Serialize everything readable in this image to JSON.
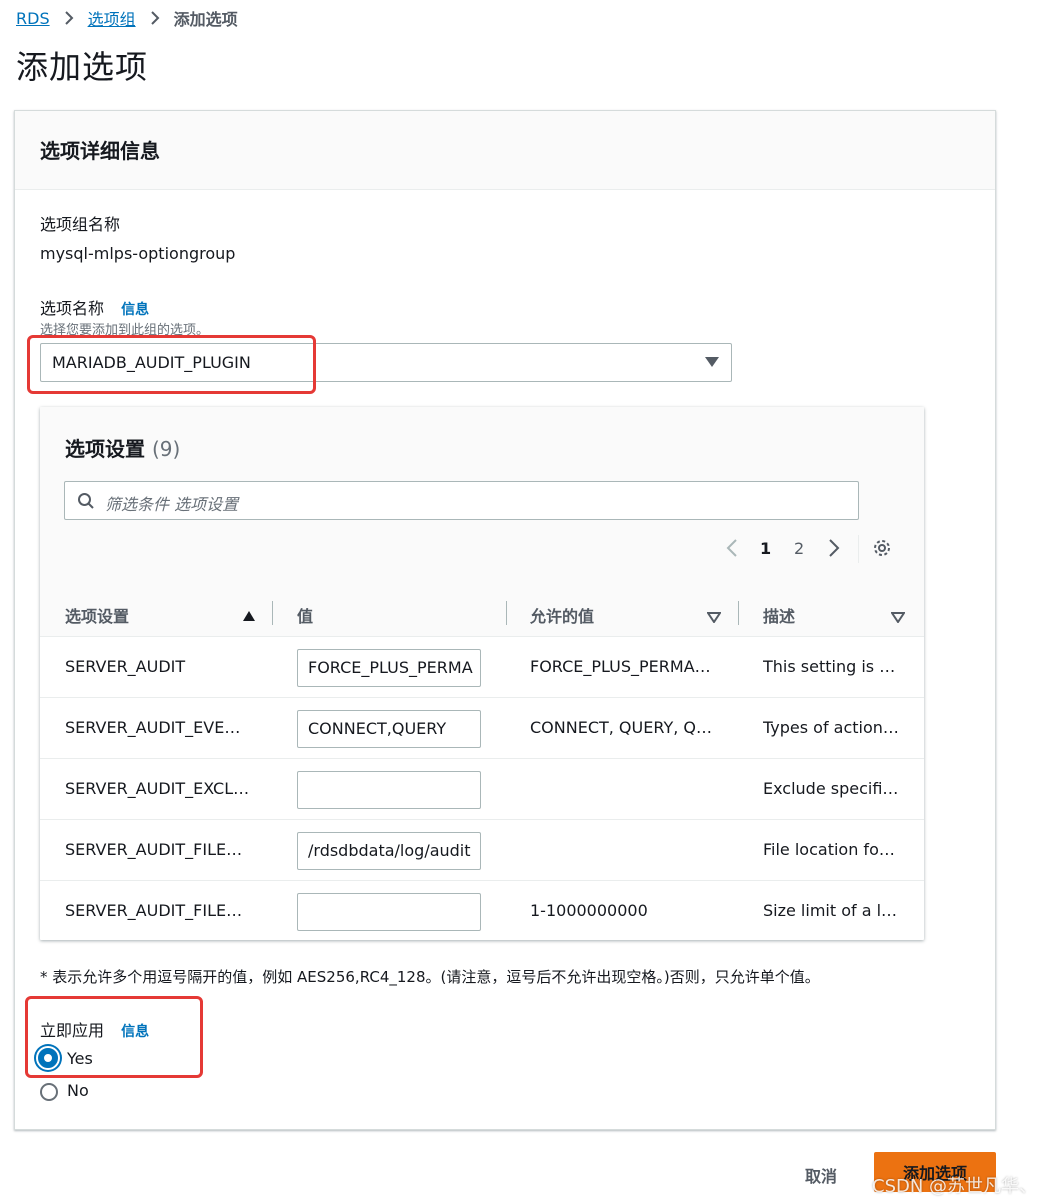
{
  "breadcrumb": {
    "rds": "RDS",
    "group": "选项组",
    "current": "添加选项"
  },
  "page_title": "添加选项",
  "panel": {
    "title": "选项详细信息",
    "group_name_label": "选项组名称",
    "group_name_value": "mysql-mlps-optiongroup",
    "option_name_label": "选项名称",
    "info": "信息",
    "option_name_hint": "选择您要添加到此组的选项。",
    "option_name_value": "MARIADB_AUDIT_PLUGIN"
  },
  "settings": {
    "title": "选项设置",
    "count": "(9)",
    "filter_placeholder": "筛选条件 选项设置",
    "pages": [
      "1",
      "2"
    ],
    "columns": {
      "name": "选项设置",
      "value": "值",
      "allowed": "允许的值",
      "desc": "描述"
    },
    "rows": [
      {
        "name": "SERVER_AUDIT",
        "value": "FORCE_PLUS_PERMA",
        "allowed": "FORCE_PLUS_PERMA…",
        "desc": "This setting is …"
      },
      {
        "name": "SERVER_AUDIT_EVE…",
        "value": "CONNECT,QUERY",
        "allowed": "CONNECT, QUERY, Q…",
        "desc": "Types of action…"
      },
      {
        "name": "SERVER_AUDIT_EXCL…",
        "value": "",
        "allowed": "",
        "desc": "Exclude specifi…"
      },
      {
        "name": "SERVER_AUDIT_FILE…",
        "value": "/rdsdbdata/log/audit",
        "allowed": "",
        "desc": "File location fo…"
      },
      {
        "name": "SERVER_AUDIT_FILE…",
        "value": "",
        "allowed": "1-1000000000",
        "desc": "Size limit of a l…"
      }
    ]
  },
  "note": "* 表示允许多个用逗号隔开的值，例如 AES256,RC4_128。(请注意，逗号后不允许出现空格。)否则，只允许单个值。",
  "apply": {
    "label": "立即应用",
    "info": "信息",
    "yes": "Yes",
    "no": "No",
    "selected": "Yes"
  },
  "footer": {
    "cancel": "取消",
    "add": "添加选项"
  },
  "watermark": "CSDN @苏世凡华、",
  "colors": {
    "link": "#0073bb",
    "primary_button": "#ec7211",
    "highlight": "#e53935"
  }
}
